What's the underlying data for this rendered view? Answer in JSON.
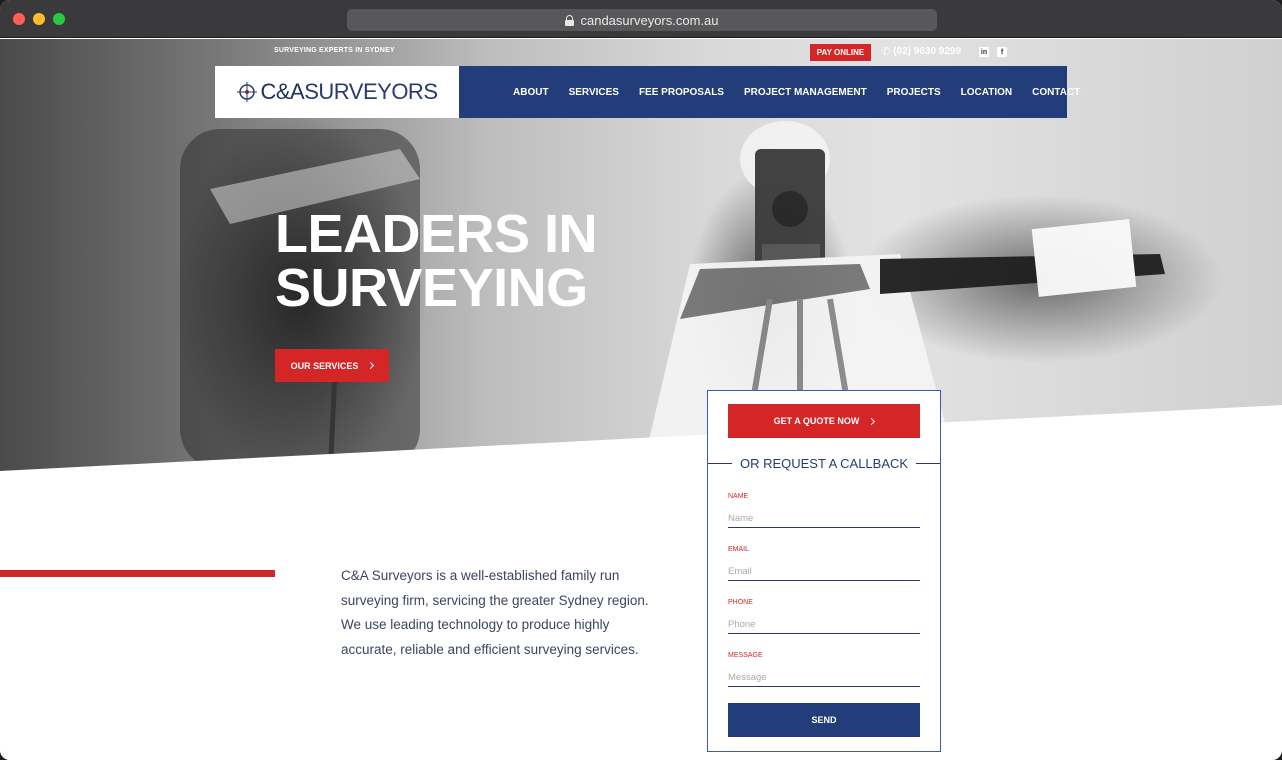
{
  "browser": {
    "url": "candasurveyors.com.au"
  },
  "topbar": {
    "tagline": "SURVEYING EXPERTS IN SYDNEY",
    "pay_online": "PAY ONLINE",
    "phone": "(02) 9630 9299",
    "social": [
      "linkedin-icon",
      "facebook-icon"
    ]
  },
  "logo": {
    "text_a": "C&A",
    "text_b": "SURVEYORS"
  },
  "nav": {
    "items": [
      {
        "label": "ABOUT"
      },
      {
        "label": "SERVICES"
      },
      {
        "label": "FEE PROPOSALS"
      },
      {
        "label": "PROJECT MANAGEMENT"
      },
      {
        "label": "PROJECTS"
      },
      {
        "label": "LOCATION"
      },
      {
        "label": "CONTACT"
      }
    ]
  },
  "hero": {
    "headline_line1": "LEADERS IN",
    "headline_line2": "SURVEYING",
    "cta": "OUR SERVICES"
  },
  "intro": {
    "text": "C&A Surveyors is a well-established family run surveying firm, servicing the greater Sydney region. We use leading technology to produce highly accurate, reliable and efficient surveying services."
  },
  "form": {
    "quote_button": "GET A QUOTE NOW",
    "callback_title": "OR REQUEST A CALLBACK",
    "fields": {
      "name": {
        "label": "NAME",
        "placeholder": "Name"
      },
      "email": {
        "label": "EMAIL",
        "placeholder": "Email"
      },
      "phone": {
        "label": "PHONE",
        "placeholder": "Phone"
      },
      "message": {
        "label": "MESSAGE",
        "placeholder": "Message"
      }
    },
    "send_button": "SEND"
  },
  "colors": {
    "brand_red": "#d42626",
    "brand_navy": "#233d7b"
  }
}
